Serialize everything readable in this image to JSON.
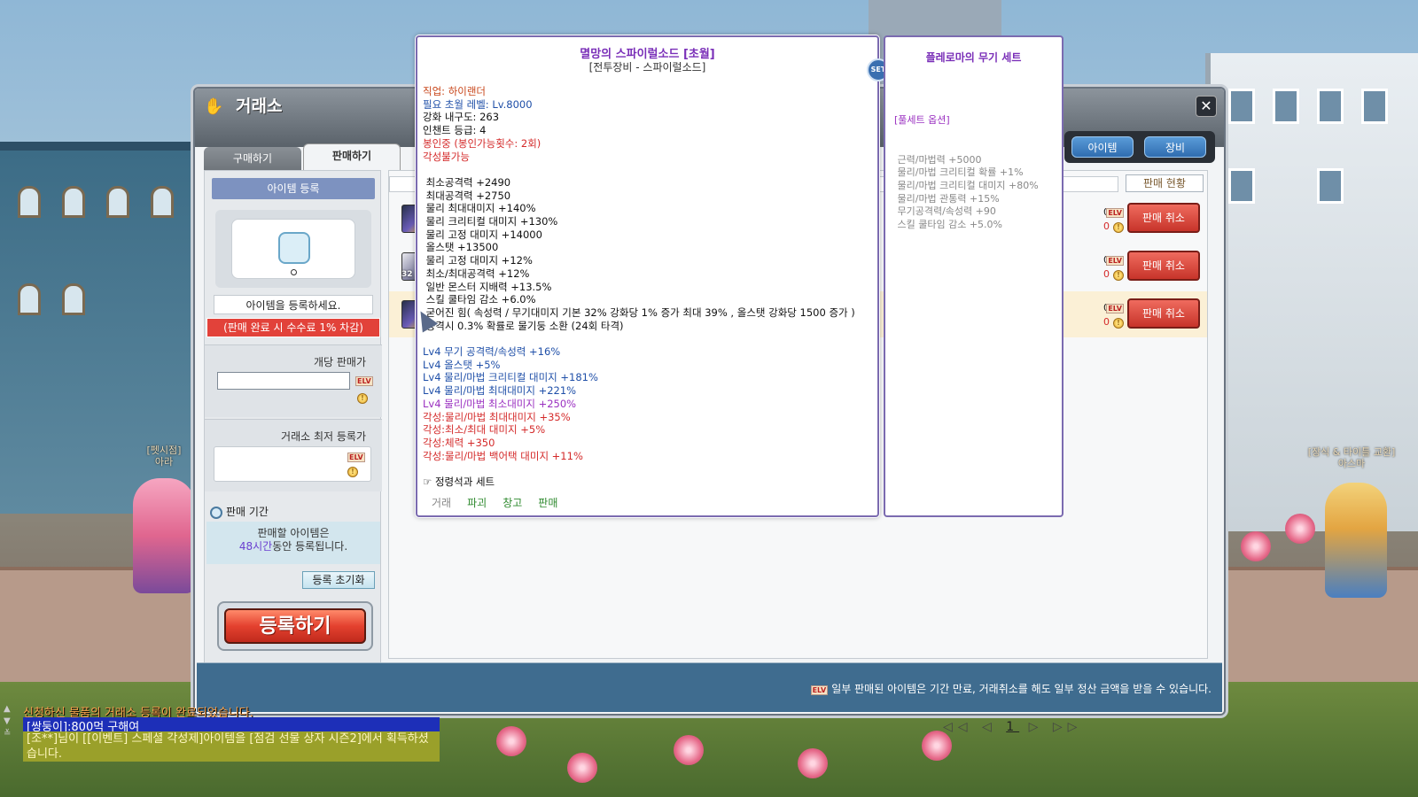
{
  "window": {
    "title": "거래소",
    "close_icon": "close-icon"
  },
  "tabs": {
    "buy": "구매하기",
    "sell": "판매하기"
  },
  "top_right": {
    "item_btn": "아이템",
    "equip_btn": "장비"
  },
  "left_panel": {
    "header": "아이템 등록",
    "register_prompt": "아이템을 등록하세요.",
    "fee_notice": "(판매 완료 시 수수료 1% 차감)",
    "unit_price_label": "개당 판매가",
    "lowest_label": "거래소 최저 등록가",
    "period_label": "판매 기간",
    "period_line1": "판매할 아이템은",
    "period_hours": "48시간",
    "period_line2": "동안 등록됩니다.",
    "reset_btn": "등록 초기화",
    "register_btn": "등록하기"
  },
  "list": {
    "status_btn": "판매 현황",
    "rows": [
      {
        "price_elv": "0",
        "price_coin": "0",
        "cancel": "판매 취소"
      },
      {
        "price_elv": "0",
        "price_coin": "0",
        "cancel": "판매 취소",
        "level_badge": "32"
      },
      {
        "price_elv": "0",
        "price_coin": "0",
        "cancel": "판매 취소"
      }
    ],
    "pager": {
      "first": "◁◁",
      "prev": "◁",
      "current": "1",
      "next": "▷",
      "last": "▷▷"
    },
    "notice": "일부 판매된 아이템은 기간 만료, 거래취소를 해도 일부 정산 금액을 받을 수 있습니다.",
    "elv_tag": "ELV"
  },
  "tooltip": {
    "title": "멸망의 스파이럴소드 [초월]",
    "subtitle": "[전투장비 - 스파이럴소드]",
    "set_badge": "SET",
    "lines": [
      {
        "t": "직업: 하이랜더",
        "c": "c-orange"
      },
      {
        "t": "필요 초월 레벨: Lv.8000",
        "c": "c-blue"
      },
      {
        "t": "강화 내구도: 263",
        "c": "c-black"
      },
      {
        "t": "인챈트 등급: 4",
        "c": "c-black"
      },
      {
        "t": "봉인중 (봉인가능횟수: 2회)",
        "c": "c-red"
      },
      {
        "t": "각성불가능",
        "c": "c-red"
      },
      {
        "t": "",
        "c": "c-black"
      },
      {
        "t": " 최소공격력 +2490",
        "c": "c-black"
      },
      {
        "t": " 최대공격력 +2750",
        "c": "c-black"
      },
      {
        "t": " 물리 최대대미지 +140%",
        "c": "c-black"
      },
      {
        "t": " 물리 크리티컬 대미지 +130%",
        "c": "c-black"
      },
      {
        "t": " 물리 고정 대미지 +14000",
        "c": "c-black"
      },
      {
        "t": " 올스탯 +13500",
        "c": "c-black"
      },
      {
        "t": " 물리 고정 대미지 +12%",
        "c": "c-black"
      },
      {
        "t": " 최소/최대공격력 +12%",
        "c": "c-black"
      },
      {
        "t": " 일반 몬스터 지배력 +13.5%",
        "c": "c-black"
      },
      {
        "t": " 스킬 쿨타임 감소 +6.0%",
        "c": "c-black"
      },
      {
        "t": " 굳어진 힘( 속성력 / 무기대미지 기본 32% 강화당 1% 증가 최대 39% , 올스탯 강화당 1500 증가 )",
        "c": "c-black"
      },
      {
        "t": " 공격시 0.3% 확률로 물기둥 소환 (24회 타격)",
        "c": "c-black"
      },
      {
        "t": "",
        "c": "c-black"
      },
      {
        "t": "Lv4 무기 공격력/속성력 +16%",
        "c": "c-blue"
      },
      {
        "t": "Lv4 올스탯 +5%",
        "c": "c-blue"
      },
      {
        "t": "Lv4 물리/마법 크리티컬 대미지 +181%",
        "c": "c-blue"
      },
      {
        "t": "Lv4 물리/마법 최대대미지 +221%",
        "c": "c-blue"
      },
      {
        "t": "Lv4 물리/마법 최소대미지 +250%",
        "c": "c-purple"
      },
      {
        "t": "각성:물리/마법 최대대미지 +35%",
        "c": "c-red"
      },
      {
        "t": "각성:최소/최대 대미지 +5%",
        "c": "c-red"
      },
      {
        "t": "각성:체력 +350",
        "c": "c-red"
      },
      {
        "t": "각성:물리/마법 백어택 대미지 +11%",
        "c": "c-red"
      },
      {
        "t": "",
        "c": "c-black"
      },
      {
        "t": "☞ 정령석과 세트",
        "c": "c-black"
      }
    ],
    "actions": [
      {
        "t": "거래",
        "c": "c-gray"
      },
      {
        "t": "파괴",
        "c": "c-green"
      },
      {
        "t": "창고",
        "c": "c-green"
      },
      {
        "t": "판매",
        "c": "c-green"
      }
    ]
  },
  "set_panel": {
    "title": "플레로마의 무기 세트",
    "header": "[풀세트 옵션]",
    "options": [
      "근력/마법력 +5000",
      "물리/마법 크리티컬 확률 +1%",
      "물리/마법 크리티컬 대미지 +80%",
      "물리/마법 관통력 +15%",
      "무기공격력/속성력 +90",
      "스킬 쿨타임 감소 +5.0%"
    ]
  },
  "npcs": {
    "left_title": "[펫시점]",
    "left_name": "아라",
    "right_title": "[장식 & 타이틀 교환]",
    "right_name": "아스마"
  },
  "chat": {
    "line1": "신청하신 물품의 거래소 등록이 완료되었습니다.",
    "line2": "[쌍둥이]:800먹 구해여",
    "line3": "[조**]님이 [[이벤트] 스페셜 각성제]아이템을 [점검 선물 상자 시즌2]에서 획득하셨습니다."
  },
  "colors": {
    "accent": "#e4412f",
    "tooltip_border": "#7b6bb0",
    "title_purple": "#7a2fb8",
    "bottom_bar": "#3f6c8f"
  }
}
